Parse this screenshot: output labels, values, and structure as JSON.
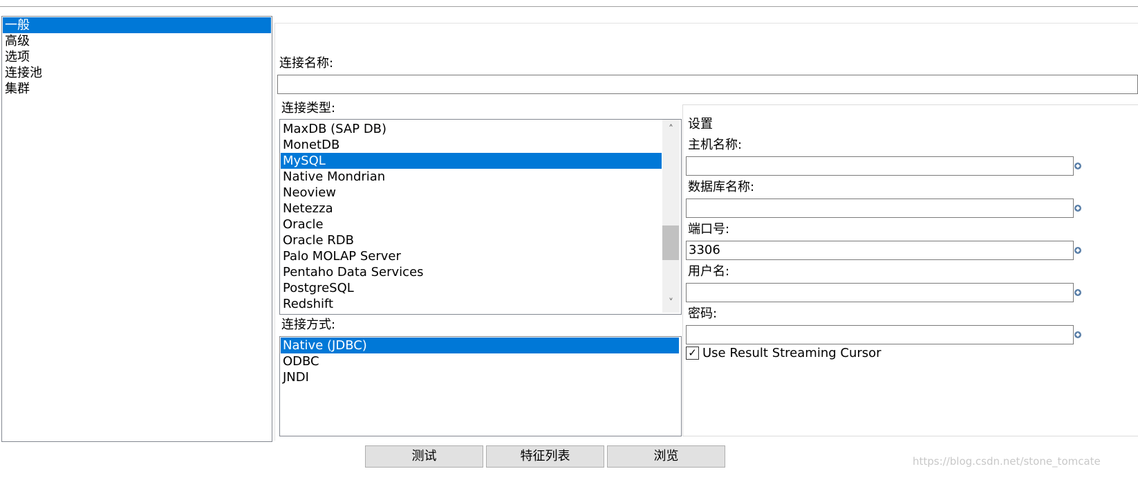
{
  "sidebar": {
    "items": [
      {
        "label": "一般",
        "selected": true
      },
      {
        "label": "高级",
        "selected": false
      },
      {
        "label": "选项",
        "selected": false
      },
      {
        "label": "连接池",
        "selected": false
      },
      {
        "label": "集群",
        "selected": false
      }
    ]
  },
  "general": {
    "connection_name_label": "连接名称:",
    "connection_name_value": "",
    "connection_type_label": "连接类型:",
    "connection_types": [
      "MaxDB (SAP DB)",
      "MonetDB",
      "MySQL",
      "Native Mondrian",
      "Neoview",
      "Netezza",
      "Oracle",
      "Oracle RDB",
      "Palo MOLAP Server",
      "Pentaho Data Services",
      "PostgreSQL",
      "Redshift"
    ],
    "connection_type_selected": "MySQL",
    "access_label": "连接方式:",
    "access_methods": [
      "Native (JDBC)",
      "ODBC",
      "JNDI"
    ],
    "access_selected": "Native (JDBC)"
  },
  "settings": {
    "title": "设置",
    "host_label": "主机名称:",
    "host_value": "",
    "db_label": "数据库名称:",
    "db_value": "",
    "port_label": "端口号:",
    "port_value": "3306",
    "user_label": "用户名:",
    "user_value": "",
    "password_label": "密码:",
    "password_value": "",
    "streaming_label": "Use Result Streaming Cursor",
    "streaming_checked": true
  },
  "buttons": {
    "test": "测试",
    "features": "特征列表",
    "explore": "浏览"
  },
  "watermark": "https://blog.csdn.net/stone_tomcate",
  "colors": {
    "selection": "#0078d7",
    "border": "#828790",
    "button_bg": "#e1e1e1"
  }
}
